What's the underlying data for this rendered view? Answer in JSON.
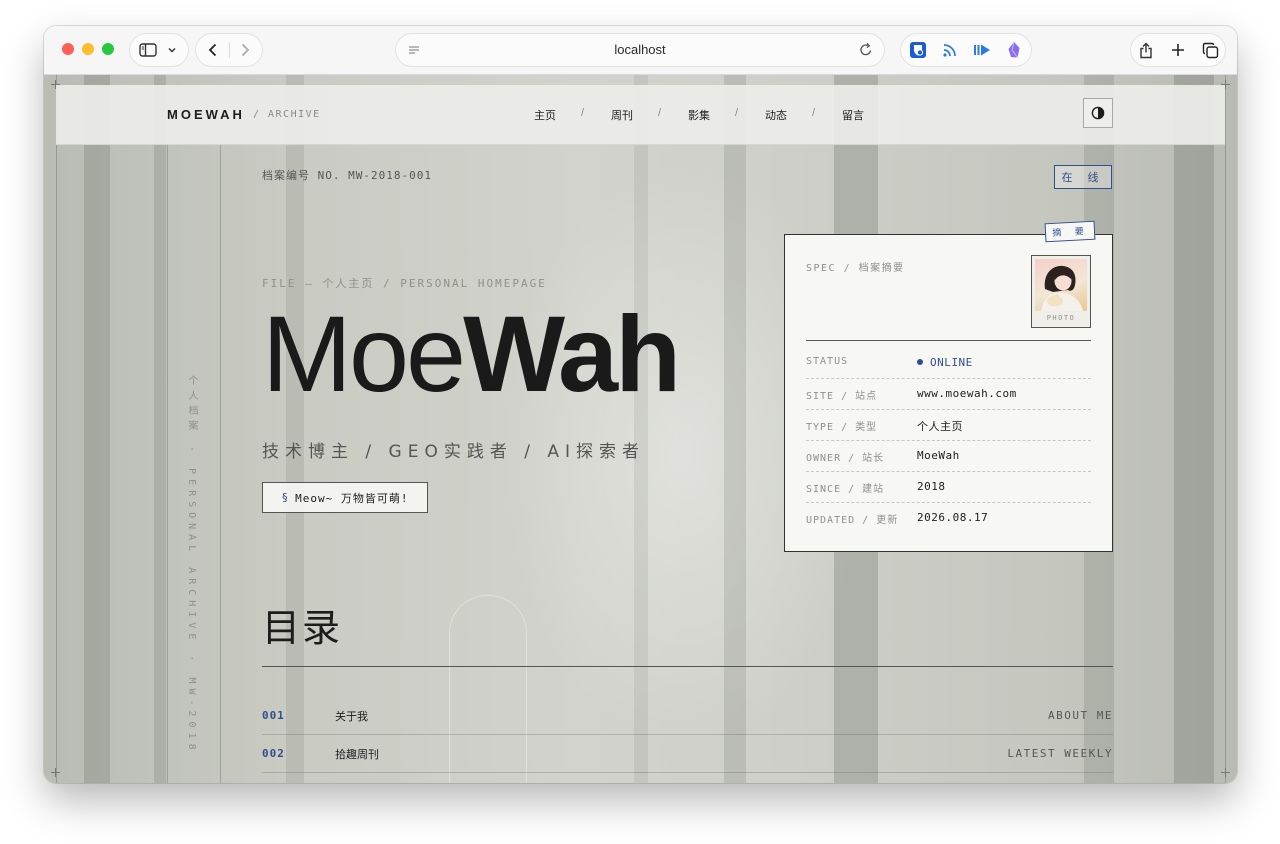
{
  "browser": {
    "address": "localhost"
  },
  "site": {
    "brand": "MOEWAH",
    "brand_sub": "/ ARCHIVE",
    "nav": [
      "主页",
      "周刊",
      "影集",
      "动态",
      "留言"
    ],
    "nav_separator": "/"
  },
  "hero": {
    "file_no": "档案编号 NO. MW-2018-001",
    "status_badge": "在 线",
    "file_path": "FILE — 个人主页 / PERSONAL HOMEPAGE",
    "title_light": "Moe",
    "title_bold": "Wah",
    "roles": "技术博主 / GEO实践者 / AI探索者",
    "motto_mark": "§",
    "motto": "Meow~ 万物皆可萌!",
    "vertical_text": "个人档案 · PERSONAL ARCHIVE · MW-2018"
  },
  "spec_card": {
    "tag": "摘 要",
    "heading": "SPEC / 档案摘要",
    "photo_caption": "PHOTO",
    "rows": [
      {
        "key": "STATUS",
        "value": "ONLINE"
      },
      {
        "key": "SITE / 站点",
        "value": "www.moewah.com"
      },
      {
        "key": "TYPE / 类型",
        "value": "个人主页"
      },
      {
        "key": "OWNER / 站长",
        "value": "MoeWah"
      },
      {
        "key": "SINCE / 建站",
        "value": "2018"
      },
      {
        "key": "UPDATED / 更新",
        "value": "2026.08.17"
      }
    ]
  },
  "toc": {
    "title": "目录",
    "items": [
      {
        "num": "001",
        "label": "关于我",
        "en": "ABOUT ME"
      },
      {
        "num": "002",
        "label": "拾趣周刊",
        "en": "LATEST WEEKLY"
      }
    ]
  },
  "colors": {
    "accent": "#2f4f8f",
    "ink": "#1d1d1d",
    "muted": "#8f908a"
  }
}
